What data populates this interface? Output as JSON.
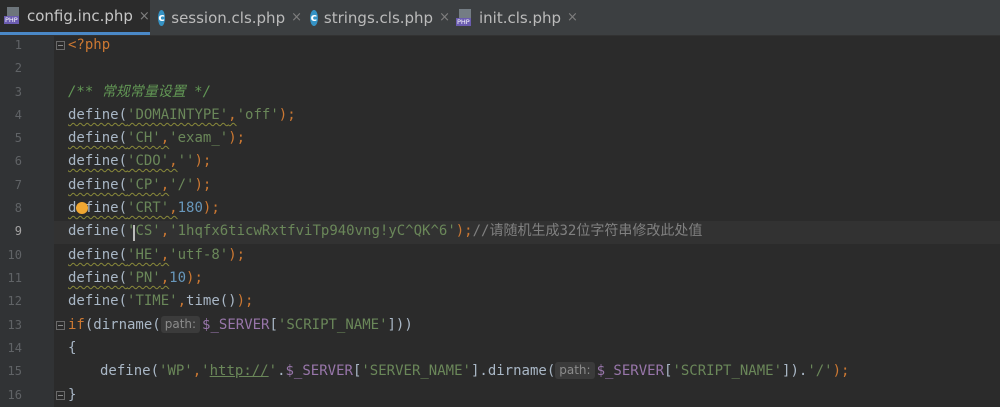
{
  "tabs": [
    {
      "label": "config.inc.php",
      "icon": "php-file-icon",
      "active": true
    },
    {
      "label": "session.cls.php",
      "icon": "class-file-icon",
      "active": false
    },
    {
      "label": "strings.cls.php",
      "icon": "class-file-icon",
      "active": false
    },
    {
      "label": "init.cls.php",
      "icon": "php-file-icon",
      "active": false
    }
  ],
  "tab_close_glyph": "×",
  "php_icon_label": "PHP",
  "class_icon_letter": "c",
  "line_numbers": [
    "1",
    "2",
    "3",
    "4",
    "5",
    "6",
    "7",
    "8",
    "9",
    "10",
    "11",
    "12",
    "13",
    "14",
    "15",
    "16"
  ],
  "current_line": "9",
  "code": {
    "l1": {
      "open": "<?php"
    },
    "l3": {
      "comment": "/** 常规常量设置 */"
    },
    "l4": {
      "fn": "define(",
      "s1": "'DOMAINTYPE'",
      "c1": ",",
      "s2": "'off'",
      "end": ");"
    },
    "l5": {
      "fn": "define(",
      "s1": "'CH'",
      "c1": ",",
      "s2": "'exam_'",
      "end": ");"
    },
    "l6": {
      "fn": "define(",
      "s1": "'CDO'",
      "c1": ",",
      "s2": "''",
      "end": ");"
    },
    "l7": {
      "fn": "define(",
      "s1": "'CP'",
      "c1": ",",
      "s2": "'/'",
      "end": ");"
    },
    "l8": {
      "fn": "define(",
      "s1": "'CRT'",
      "c1": ",",
      "n2": "180",
      "end": ");"
    },
    "l9": {
      "fn": "define(",
      "s1": "'CS'",
      "c1": ",",
      "s2": "'1hqfx6ticwRxtfviTp940vng!yC^QK^6'",
      "end": ");",
      "comment": "//请随机生成32位字符串修改此处值"
    },
    "l10": {
      "fn": "define(",
      "s1": "'HE'",
      "c1": ",",
      "s2": "'utf-8'",
      "end": ");"
    },
    "l11": {
      "fn": "define(",
      "s1": "'PN'",
      "c1": ",",
      "n2": "10",
      "end": ");"
    },
    "l12": {
      "fn": "define(",
      "s1": "'TIME'",
      "c1": ",",
      "f2": "time()",
      "end": ");"
    },
    "l13": {
      "kw": "if",
      "a": "(dirname(",
      "hint": "path:",
      "var": "$_SERVER",
      "b": "[",
      "s": "'SCRIPT_NAME'",
      "c": "]))"
    },
    "l14": {
      "brace": "{"
    },
    "l15": {
      "fn": "define(",
      "s1": "'WP'",
      "c1": ",",
      "s2a": "'",
      "url": "http://",
      "s2b": "'",
      "dot1": ".",
      "var1": "$_SERVER",
      "br1": "[",
      "s3": "'SERVER_NAME'",
      "br2": "]",
      ".dirname": ".dirname(",
      "hint": "path:",
      "var2": "$_SERVER",
      "br3": "[",
      "s4": "'SCRIPT_NAME'",
      "br4": "])",
      "dot2": ".",
      "s5": "'/'",
      "end": ");"
    },
    "l16": {
      "brace": "}"
    }
  },
  "colors": {
    "background": "#2b2b2b",
    "keyword": "#cc7832",
    "string": "#6a8759",
    "number": "#6897bb",
    "variable": "#9876aa",
    "doc_comment": "#629755",
    "line_comment": "#808080",
    "active_tab_underline": "#4a88c7"
  }
}
